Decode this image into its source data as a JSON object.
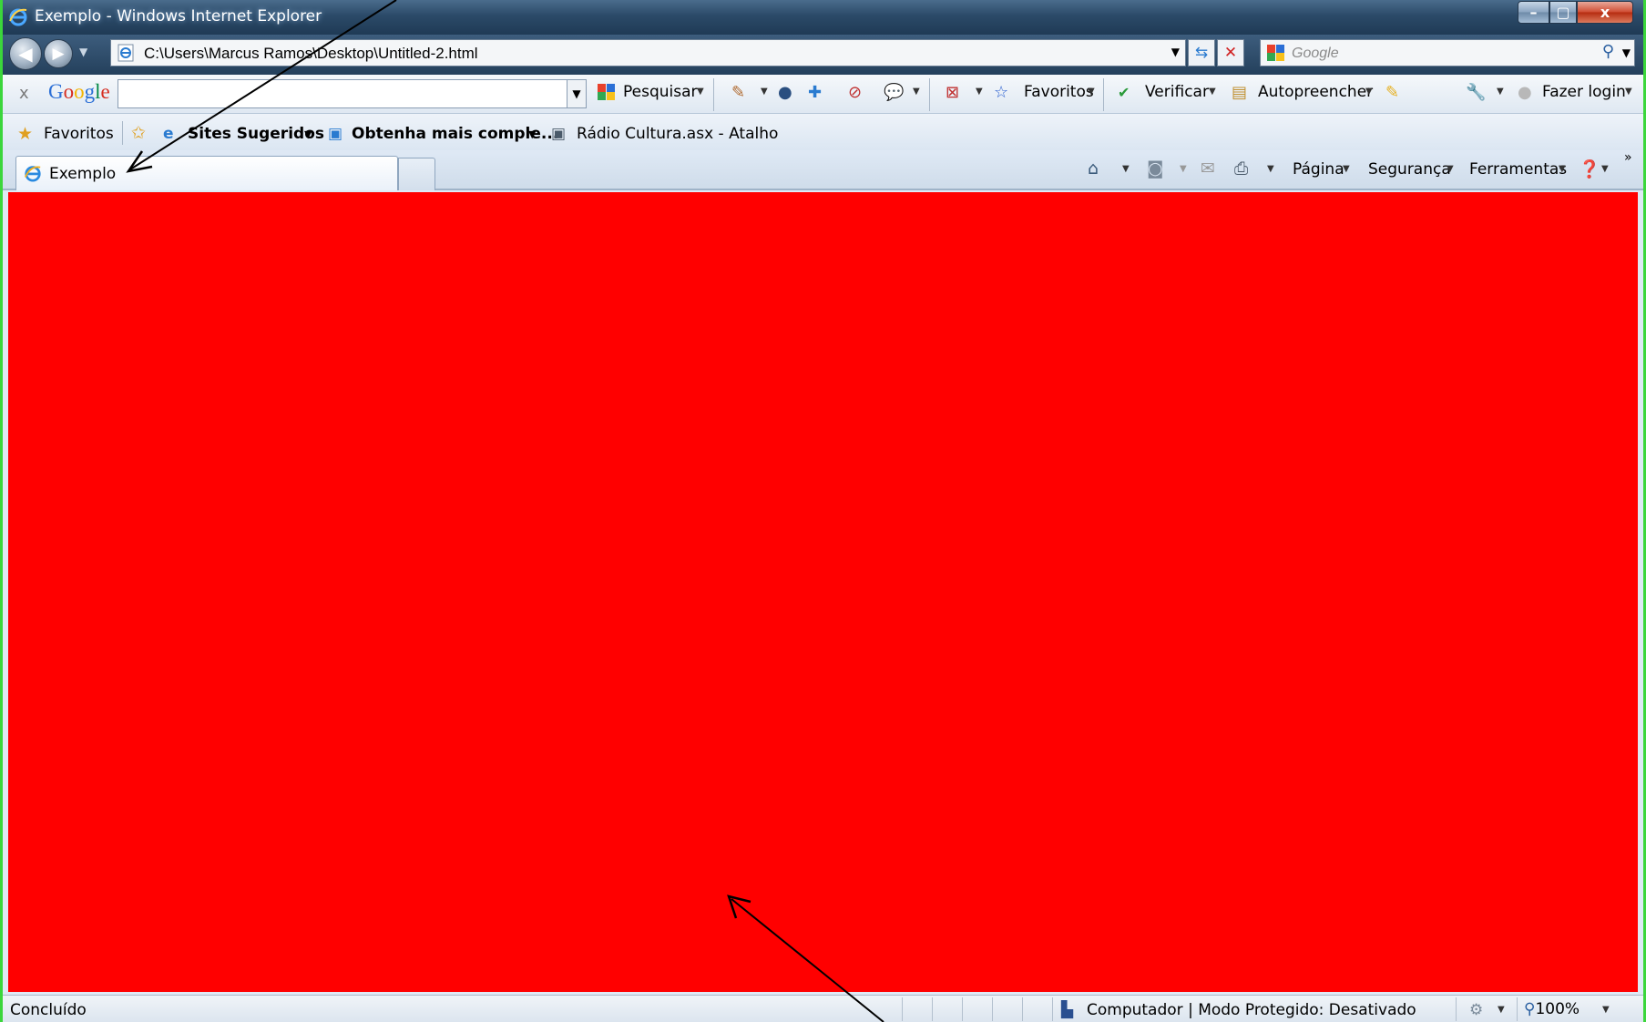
{
  "window": {
    "title": "Exemplo - Windows Internet Explorer",
    "controls": {
      "minimize": "–",
      "maximize": "▢",
      "close": "x"
    }
  },
  "address_bar": {
    "url": "C:\\Users\\Marcus Ramos\\Desktop\\Untitled-2.html",
    "search_placeholder": "Google"
  },
  "google_toolbar": {
    "logo": "Google",
    "search_value": "",
    "items": {
      "pesquisar": "Pesquisar",
      "favoritos": "Favoritos",
      "verificar": "Verificar",
      "autopreencher": "Autopreencher",
      "fazer_login": "Fazer login"
    }
  },
  "favorites_bar": {
    "favoritos": "Favoritos",
    "sites_sugeridos": "Sites Sugeridos",
    "obtenha": "Obtenha mais comple...",
    "radio": "Rádio Cultura.asx - Atalho"
  },
  "tabs": [
    {
      "label": "Exemplo"
    }
  ],
  "command_bar": {
    "pagina": "Página",
    "seguranca": "Segurança",
    "ferramentas": "Ferramentas",
    "more": "»"
  },
  "status_bar": {
    "status": "Concluído",
    "zone": "Computador | Modo Protegido: Desativado",
    "zoom": "100%"
  },
  "colors": {
    "page_background": "#ff0000",
    "slide_background": "#3bd63b"
  }
}
